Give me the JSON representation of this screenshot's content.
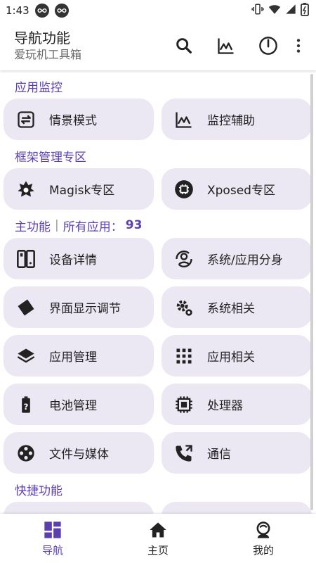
{
  "status_bar": {
    "time": "1:43"
  },
  "app_bar": {
    "title": "导航功能",
    "subtitle": "爱玩机工具箱"
  },
  "sections": {
    "monitor": {
      "title": "应用监控",
      "items": [
        {
          "label": "情景模式",
          "icon": "scene-icon"
        },
        {
          "label": "监控辅助",
          "icon": "chart-icon"
        }
      ]
    },
    "framework": {
      "title": "框架管理专区",
      "items": [
        {
          "label": "Magisk专区",
          "icon": "magisk-icon"
        },
        {
          "label": "Xposed专区",
          "icon": "xposed-icon"
        }
      ]
    },
    "main": {
      "title": "主功能",
      "separator": "|",
      "apps_label": "所有应用：",
      "apps_count": "93",
      "items": [
        {
          "label": "设备详情",
          "icon": "device-icon"
        },
        {
          "label": "系统/应用分身",
          "icon": "clone-icon"
        },
        {
          "label": "界面显示调节",
          "icon": "display-icon"
        },
        {
          "label": "系统相关",
          "icon": "system-gear-icon"
        },
        {
          "label": "应用管理",
          "icon": "layers-icon"
        },
        {
          "label": "应用相关",
          "icon": "apps-grid-icon"
        },
        {
          "label": "电池管理",
          "icon": "battery-icon"
        },
        {
          "label": "处理器",
          "icon": "cpu-icon"
        },
        {
          "label": "文件与媒体",
          "icon": "film-reel-icon"
        },
        {
          "label": "通信",
          "icon": "phone-icon"
        }
      ]
    },
    "shortcuts": {
      "title": "快捷功能"
    }
  },
  "bottom_nav": {
    "items": [
      {
        "label": "导航",
        "icon": "dashboard-icon",
        "active": true
      },
      {
        "label": "主页",
        "icon": "home-icon",
        "active": false
      },
      {
        "label": "我的",
        "icon": "profile-icon",
        "active": false
      }
    ]
  },
  "colors": {
    "accent": "#5b3fb0",
    "tile_bg": "#ebe7f3",
    "text": "#222222"
  }
}
